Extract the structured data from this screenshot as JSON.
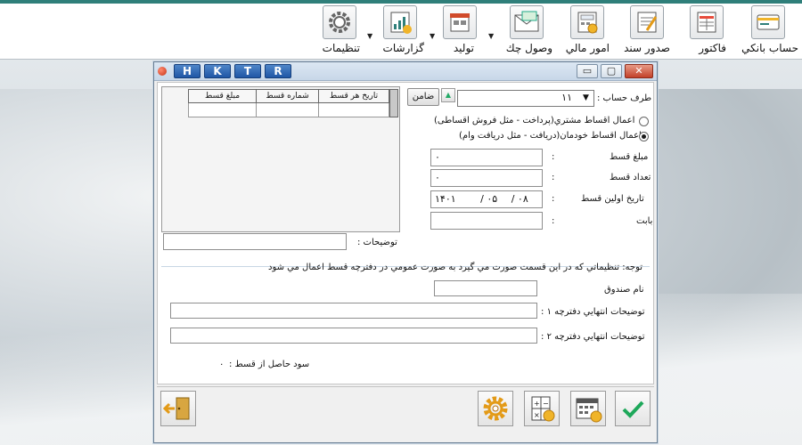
{
  "toolbar": {
    "items": [
      {
        "label": "حساب بانكي",
        "icon": "bank-account-icon"
      },
      {
        "label": "فاكتور",
        "icon": "invoice-icon"
      },
      {
        "label": "صدور سند",
        "icon": "voucher-icon"
      },
      {
        "label": "امور مالي",
        "icon": "finance-icon"
      },
      {
        "label": "وصول چك",
        "icon": "check-receive-icon"
      },
      {
        "label": "توليد",
        "icon": "production-icon"
      },
      {
        "label": "گزارشات",
        "icon": "reports-icon"
      },
      {
        "label": "تنظيمات",
        "icon": "settings-icon"
      }
    ]
  },
  "window": {
    "keys": [
      "H",
      "K",
      "T",
      "R"
    ],
    "controls": {
      "minimize": "▭",
      "maximize": "▢",
      "close": "✕"
    }
  },
  "table": {
    "columns": [
      "تاريخ هر قسط",
      "شماره قسط",
      "مبلغ قسط"
    ]
  },
  "form": {
    "account_label": "طرف حساب :",
    "account_value": "١١",
    "guarantor_button": "ضامن",
    "radio1_label": "اعمال اقساط مشتري(پرداخت - مثل فروش اقساطی)",
    "radio2_label": "اعمال اقساط خودمان(دريافت - مثل دريافت وام)",
    "selected_radio": 2,
    "amount_label": "مبلغ قسط",
    "amount_value": "٠",
    "count_label": "تعداد قسط",
    "count_value": "٠",
    "first_date_label": "تاريخ اولين قسط",
    "date_year": "١۴٠١",
    "date_month": "٠۵",
    "date_day": "٠٨",
    "regarding_label": "بابت",
    "description_label": "توضيحات :",
    "colon": ":"
  },
  "settings": {
    "note": "توجه: تنظيماتي كه در اين قسمت صورت مي گيرد به صورت عمومي در دفترچه قسط اعمال مي شود",
    "fund_label": "نام صندوق",
    "book1_label": "توضيحات انتهايي دفترچه ١ :",
    "book2_label": "توضيحات انتهايي دفترچه ٢ :",
    "profit_label": "سود حاصل از قسط :",
    "profit_value": "٠"
  },
  "footer": {
    "buttons": [
      "exit-icon",
      "settings-icon",
      "calculator-icon",
      "calendar-icon",
      "confirm-icon"
    ]
  },
  "colors": {
    "accent": "#2f7f7a",
    "key_blue": "#1f56a5",
    "confirm_green": "#1ea85a",
    "gear_orange": "#e39a17"
  }
}
